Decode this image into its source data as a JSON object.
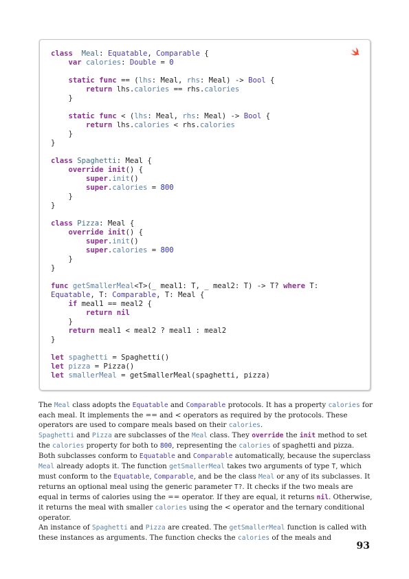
{
  "code": {
    "language_icon": "swift-logo-icon",
    "lines": [
      [
        [
          "kw",
          "class"
        ],
        [
          "",
          "  "
        ],
        [
          "ty",
          "Meal"
        ],
        [
          "",
          ": "
        ],
        [
          "pt",
          "Equatable"
        ],
        [
          "",
          ", "
        ],
        [
          "pt",
          "Comparable"
        ],
        [
          "",
          " {"
        ]
      ],
      [
        [
          "",
          "    "
        ],
        [
          "kw",
          "var"
        ],
        [
          "",
          " "
        ],
        [
          "pr",
          "calories"
        ],
        [
          "",
          ": "
        ],
        [
          "pt",
          "Double"
        ],
        [
          "",
          " = "
        ],
        [
          "nm",
          "0"
        ]
      ],
      [
        [
          "",
          ""
        ]
      ],
      [
        [
          "",
          "    "
        ],
        [
          "kw",
          "static"
        ],
        [
          "",
          " "
        ],
        [
          "kw",
          "func"
        ],
        [
          "",
          " == ("
        ],
        [
          "pr",
          "lhs"
        ],
        [
          "",
          ": Meal, "
        ],
        [
          "pr",
          "rhs"
        ],
        [
          "",
          ": Meal) -> "
        ],
        [
          "pt",
          "Bool"
        ],
        [
          "",
          " {"
        ]
      ],
      [
        [
          "",
          "        "
        ],
        [
          "kw",
          "return"
        ],
        [
          "",
          " lhs."
        ],
        [
          "pr",
          "calories"
        ],
        [
          "",
          " == rhs."
        ],
        [
          "pr",
          "calories"
        ]
      ],
      [
        [
          "",
          "    }"
        ]
      ],
      [
        [
          "",
          ""
        ]
      ],
      [
        [
          "",
          "    "
        ],
        [
          "kw",
          "static"
        ],
        [
          "",
          " "
        ],
        [
          "kw",
          "func"
        ],
        [
          "",
          " < ("
        ],
        [
          "pr",
          "lhs"
        ],
        [
          "",
          ": Meal, "
        ],
        [
          "pr",
          "rhs"
        ],
        [
          "",
          ": Meal) -> "
        ],
        [
          "pt",
          "Bool"
        ],
        [
          "",
          " {"
        ]
      ],
      [
        [
          "",
          "        "
        ],
        [
          "kw",
          "return"
        ],
        [
          "",
          " lhs."
        ],
        [
          "pr",
          "calories"
        ],
        [
          "",
          " < rhs."
        ],
        [
          "pr",
          "calories"
        ]
      ],
      [
        [
          "",
          "    }"
        ]
      ],
      [
        [
          "",
          "}"
        ]
      ],
      [
        [
          "",
          ""
        ]
      ],
      [
        [
          "kw",
          "class"
        ],
        [
          "",
          " "
        ],
        [
          "ty",
          "Spaghetti"
        ],
        [
          "",
          ": Meal {"
        ]
      ],
      [
        [
          "",
          "    "
        ],
        [
          "kw",
          "override"
        ],
        [
          "",
          " "
        ],
        [
          "kw",
          "init"
        ],
        [
          "",
          "() {"
        ]
      ],
      [
        [
          "",
          "        "
        ],
        [
          "kw",
          "super"
        ],
        [
          "",
          "."
        ],
        [
          "pr",
          "init"
        ],
        [
          "",
          "()"
        ]
      ],
      [
        [
          "",
          "        "
        ],
        [
          "kw",
          "super"
        ],
        [
          "",
          "."
        ],
        [
          "pr",
          "calories"
        ],
        [
          "",
          " = "
        ],
        [
          "nm",
          "800"
        ]
      ],
      [
        [
          "",
          "    }"
        ]
      ],
      [
        [
          "",
          "}"
        ]
      ],
      [
        [
          "",
          ""
        ]
      ],
      [
        [
          "kw",
          "class"
        ],
        [
          "",
          " "
        ],
        [
          "ty",
          "Pizza"
        ],
        [
          "",
          ": Meal {"
        ]
      ],
      [
        [
          "",
          "    "
        ],
        [
          "kw",
          "override"
        ],
        [
          "",
          " "
        ],
        [
          "kw",
          "init"
        ],
        [
          "",
          "() {"
        ]
      ],
      [
        [
          "",
          "        "
        ],
        [
          "kw",
          "super"
        ],
        [
          "",
          "."
        ],
        [
          "pr",
          "init"
        ],
        [
          "",
          "()"
        ]
      ],
      [
        [
          "",
          "        "
        ],
        [
          "kw",
          "super"
        ],
        [
          "",
          "."
        ],
        [
          "pr",
          "calories"
        ],
        [
          "",
          " = "
        ],
        [
          "nm",
          "800"
        ]
      ],
      [
        [
          "",
          "    }"
        ]
      ],
      [
        [
          "",
          "}"
        ]
      ],
      [
        [
          "",
          ""
        ]
      ],
      [
        [
          "kw",
          "func"
        ],
        [
          "",
          " "
        ],
        [
          "pr",
          "getSmallerMeal"
        ],
        [
          "",
          "<T>(_ meal1: T, _ meal2: T) -> T? "
        ],
        [
          "kw",
          "where"
        ],
        [
          "",
          " T:"
        ]
      ],
      [
        [
          "pt",
          "Equatable"
        ],
        [
          "",
          ", T: "
        ],
        [
          "pt",
          "Comparable"
        ],
        [
          "",
          ", T: Meal {"
        ]
      ],
      [
        [
          "",
          "    "
        ],
        [
          "kw",
          "if"
        ],
        [
          "",
          " meal1 == meal2 {"
        ]
      ],
      [
        [
          "",
          "        "
        ],
        [
          "kw",
          "return"
        ],
        [
          "",
          " "
        ],
        [
          "kw",
          "nil"
        ]
      ],
      [
        [
          "",
          "    }"
        ]
      ],
      [
        [
          "",
          "    "
        ],
        [
          "kw",
          "return"
        ],
        [
          "",
          " meal1 < meal2 ? meal1 : meal2"
        ]
      ],
      [
        [
          "",
          "}"
        ]
      ],
      [
        [
          "",
          ""
        ]
      ],
      [
        [
          "kw",
          "let"
        ],
        [
          "",
          " "
        ],
        [
          "pr",
          "spaghetti"
        ],
        [
          "",
          " = Spaghetti()"
        ]
      ],
      [
        [
          "kw",
          "let"
        ],
        [
          "",
          " "
        ],
        [
          "pr",
          "pizza"
        ],
        [
          "",
          " = Pizza()"
        ]
      ],
      [
        [
          "kw",
          "let"
        ],
        [
          "",
          " "
        ],
        [
          "pr",
          "smallerMeal"
        ],
        [
          "",
          " = getSmallerMeal(spaghetti, pizza)"
        ]
      ]
    ]
  },
  "paragraphs": [
    [
      [
        "",
        "The "
      ],
      [
        "pr",
        "Meal"
      ],
      [
        "",
        " class adopts the "
      ],
      [
        "pt",
        "Equatable"
      ],
      [
        "",
        " and "
      ],
      [
        "pt",
        "Comparable"
      ],
      [
        "",
        " protocols. It has a property "
      ],
      [
        "pr",
        "calories"
      ],
      [
        "",
        " for each meal. It implements the == and < operators as required by the protocols. These operators are used to compare meals based on their "
      ],
      [
        "pr",
        "calories"
      ],
      [
        "",
        "."
      ],
      [
        "br",
        ""
      ],
      [
        "pr",
        "Spaghetti"
      ],
      [
        "",
        " and "
      ],
      [
        "pr",
        "Pizza"
      ],
      [
        "",
        " are subclasses of the "
      ],
      [
        "pr",
        "Meal"
      ],
      [
        "",
        " class. They "
      ],
      [
        "kw",
        "override"
      ],
      [
        "",
        " the "
      ],
      [
        "kw",
        "init"
      ],
      [
        "",
        " method to set the "
      ],
      [
        "pr",
        "calories"
      ],
      [
        "",
        " property for both to "
      ],
      [
        "nm",
        "800"
      ],
      [
        "",
        ", representing the "
      ],
      [
        "pr",
        "calories"
      ],
      [
        "",
        " of spaghetti and pizza. Both subclasses conform to "
      ],
      [
        "pt",
        "Equatable"
      ],
      [
        "",
        " and "
      ],
      [
        "pt",
        "Comparable"
      ],
      [
        "",
        " automatically, because the superclass "
      ],
      [
        "pr",
        "Meal"
      ],
      [
        "",
        " already adopts it. The function "
      ],
      [
        "pr",
        "getSmallerMeal"
      ],
      [
        "",
        " takes two arguments of type "
      ],
      [
        "plain",
        "T"
      ],
      [
        "",
        ", which must conform to the "
      ],
      [
        "pt",
        "Equatable"
      ],
      [
        "",
        ", "
      ],
      [
        "pt",
        "Comparable"
      ],
      [
        "",
        ", and be the class "
      ],
      [
        "pr",
        "Meal"
      ],
      [
        "",
        " or any of its subclasses. It returns an optional meal using the generic parameter "
      ],
      [
        "plain",
        "T?"
      ],
      [
        "",
        ". It checks if the two meals are equal in terms of calories using the == operator. If they are equal, it returns "
      ],
      [
        "kw",
        "nil"
      ],
      [
        "",
        ". Otherwise, it returns the meal with smaller "
      ],
      [
        "pr",
        "calories"
      ],
      [
        "",
        " using the < operator and the ternary conditional operator."
      ]
    ],
    [
      [
        "",
        "An instance of "
      ],
      [
        "pr",
        "Spaghetti"
      ],
      [
        "",
        " and "
      ],
      [
        "pr",
        "Pizza"
      ],
      [
        "",
        " are created. The "
      ],
      [
        "pr",
        "getSmallerMeal"
      ],
      [
        "",
        " function is called with these instances as arguments. The function checks the "
      ],
      [
        "pr",
        "calories"
      ],
      [
        "",
        " of the meals and"
      ]
    ]
  ],
  "page_number": "93"
}
